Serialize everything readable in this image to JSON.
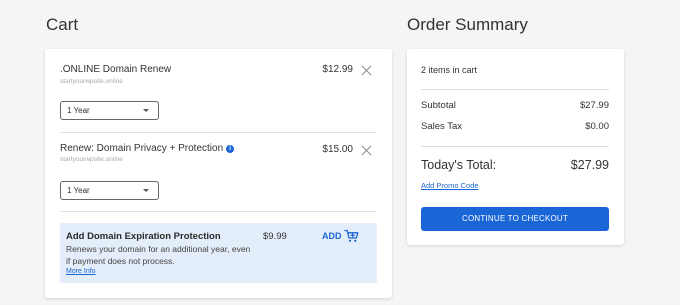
{
  "cart": {
    "heading": "Cart",
    "items": [
      {
        "name": ".ONLINE Domain Renew",
        "domain": "startyourwpsite.online",
        "price": "$12.99",
        "term": "1 Year",
        "remove_icon": "close-icon"
      },
      {
        "name": "Renew: Domain Privacy + Protection",
        "domain": "startyourwpsite.online",
        "price": "$15.00",
        "term": "1 Year",
        "info_icon": "info-icon",
        "remove_icon": "close-icon"
      }
    ],
    "upsell": {
      "title": "Add Domain Expiration Protection",
      "description": "Renews your domain for an additional year, even if payment does not process.",
      "link": "More Info",
      "price": "$9.99",
      "add_label": "ADD",
      "add_icon": "cart-add-icon"
    }
  },
  "summary": {
    "heading": "Order Summary",
    "items_count": "2 items in cart",
    "subtotal_label": "Subtotal",
    "subtotal_value": "$27.99",
    "tax_label": "Sales Tax",
    "tax_value": "$0.00",
    "total_label": "Today's Total:",
    "total_value": "$27.99",
    "promo_link": "Add Promo Code",
    "checkout_label": "CONTINUE TO CHECKOUT"
  },
  "colors": {
    "accent": "#1a66d6",
    "upsell_bg": "#e4edfa",
    "page_bg": "#f4f5f7"
  }
}
